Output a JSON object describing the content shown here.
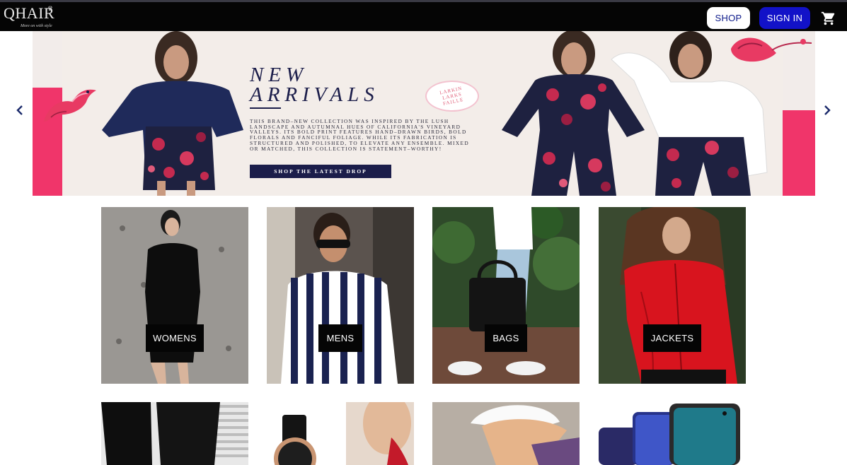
{
  "navbar": {
    "logo_text": "QHAIR",
    "logo_tagline": "More on with style",
    "shop_label": "SHOP",
    "signin_label": "SIGN IN",
    "cart_icon": "shopping-cart-icon"
  },
  "hero": {
    "title_line1": "NEW",
    "title_line2": "ARRIVALS",
    "seal_text": "LARKIN LARKS FAILLE",
    "body": "This brand–new collection was inspired by the lush landscape and autumnal hues of California's vineyard valleys. Its bold print features hand–drawn birds, bold florals and fanciful foliage. While its fabrication is structured and polished, to elevate any ensemble. Mixed or matched, this collection is statement–worthy!",
    "cta_label": "SHOP THE LATEST DROP",
    "prev_icon": "chevron-left-icon",
    "next_icon": "chevron-right-icon"
  },
  "categories": [
    {
      "label": "WOMENS"
    },
    {
      "label": "MENS"
    },
    {
      "label": "BAGS"
    },
    {
      "label": "JACKETS"
    }
  ],
  "colors": {
    "navbar_bg": "#050505",
    "signin_bg": "#1212c8",
    "shop_text": "#0d1a8a",
    "banner_pink": "#f0356a",
    "banner_navy": "#1b1d4a",
    "tile_label_bg": "#050505"
  }
}
